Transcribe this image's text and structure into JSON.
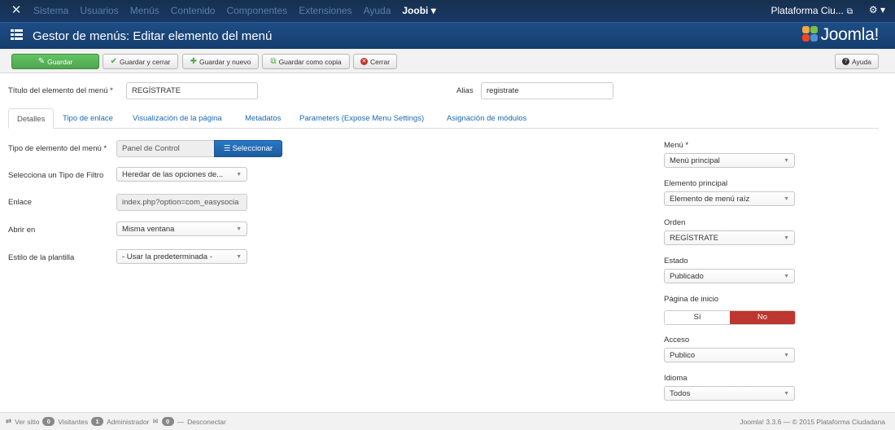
{
  "topbar": {
    "menu": [
      "Sistema",
      "Usuarios",
      "Menús",
      "Contenido",
      "Componentes",
      "Extensiones",
      "Ayuda"
    ],
    "joobi": "Joobi ▾",
    "site": "Plataforma Ciu...",
    "gear": "⚙ ▾"
  },
  "header": {
    "title": "Gestor de menús: Editar elemento del menú",
    "logo": "Joomla!"
  },
  "toolbar": {
    "save": "Guardar",
    "save_close": "Guardar y cerrar",
    "save_new": "Guardar y nuevo",
    "save_copy": "Guardar como copia",
    "close": "Cerrar",
    "help": "Ayuda"
  },
  "form": {
    "title_label": "Título del elemento del menú *",
    "title_value": "REGÍSTRATE",
    "alias_label": "Alias",
    "alias_value": "registrate"
  },
  "tabs": [
    "Detalles",
    "Tipo de enlace",
    "Visualización de la página",
    "Metadatos",
    "Parameters (Expose Menu Settings)",
    "Asignación de módulos"
  ],
  "details": {
    "type_label": "Tipo de elemento del menú *",
    "type_value": "Panel de Control",
    "select_button": "Seleccionar",
    "filter_label": "Selecciona un Tipo de Filtro",
    "filter_value": "Heredar de las opciones de...",
    "link_label": "Enlace",
    "link_value": "index.php?option=com_easysocia",
    "open_label": "Abrir en",
    "open_value": "Misma ventana",
    "style_label": "Estilo de la plantilla",
    "style_value": "- Usar la predeterminada -"
  },
  "sidebar": {
    "menu_label": "Menú *",
    "menu_value": "Menú principal",
    "parent_label": "Elemento principal",
    "parent_value": "Elemento de menú raíz",
    "order_label": "Orden",
    "order_value": "REGÍSTRATE",
    "state_label": "Estado",
    "state_value": "Publicado",
    "home_label": "Página de inicio",
    "home_yes": "Sí",
    "home_no": "No",
    "access_label": "Acceso",
    "access_value": "Publico",
    "language_label": "Idioma",
    "language_value": "Todos"
  },
  "statusbar": {
    "view_site": "Ver sitio",
    "visitors_count": "0",
    "visitors": "Visitantes",
    "admin_count": "1",
    "admin": "Administrador",
    "messages_count": "0",
    "logout": "Desconectar",
    "version": "Joomla! 3.3.6 — © 2015 Plataforma Ciudadana"
  },
  "colors": {
    "navbar": "#1a3867",
    "header": "#1d4d85",
    "save_green": "#51a351",
    "select_blue": "#1e5d9e",
    "no_red": "#bd362f",
    "link": "#1a6ab5"
  }
}
